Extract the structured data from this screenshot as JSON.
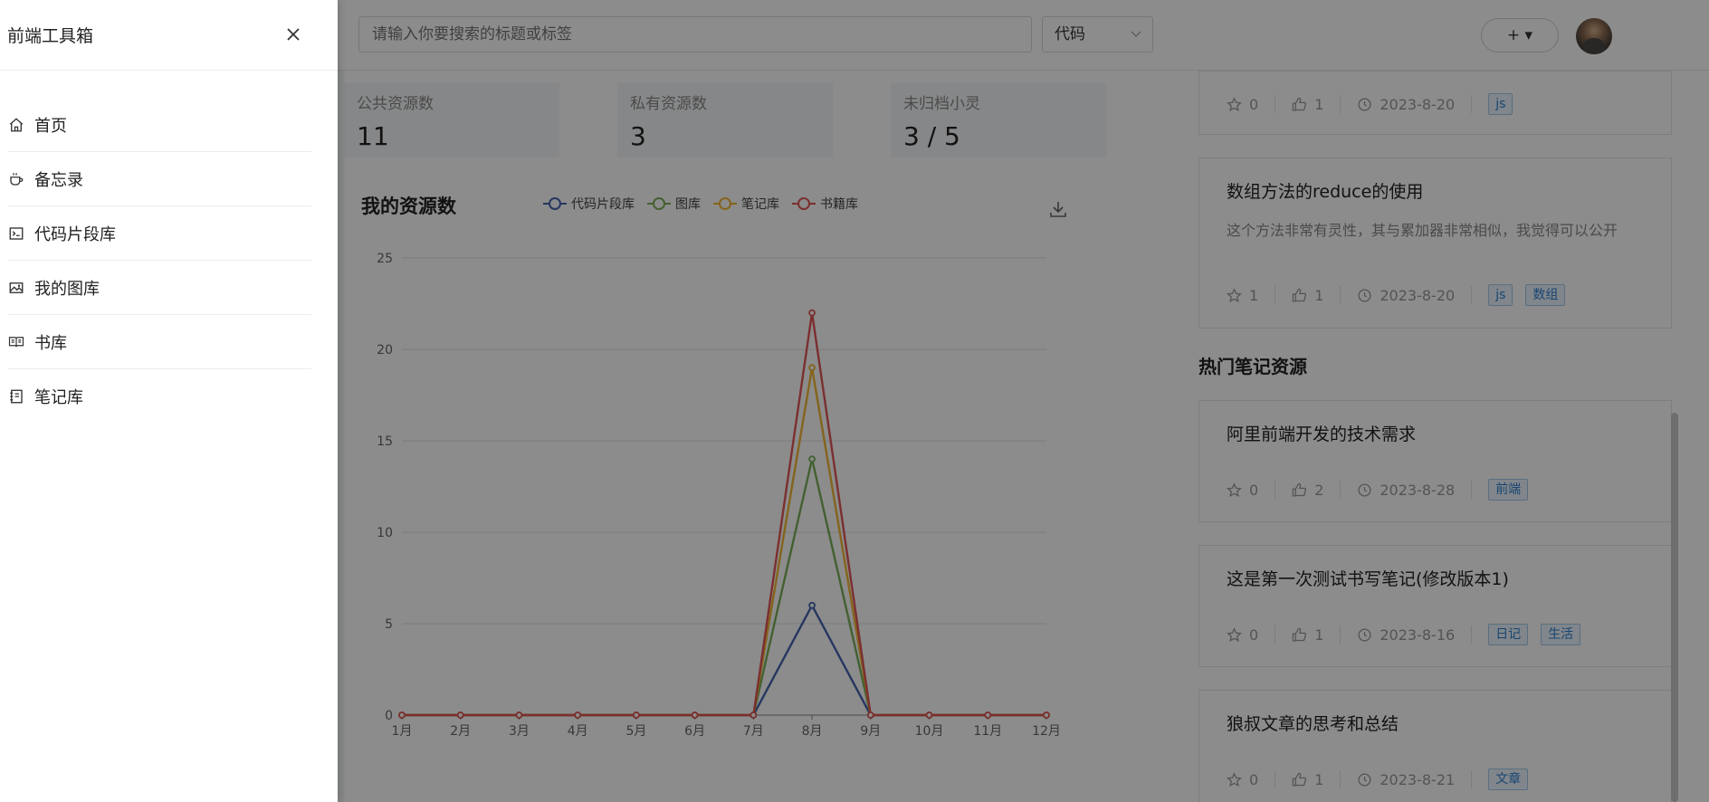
{
  "topbar": {
    "search_placeholder": "请输入你要搜索的标题或标签",
    "select_value": "代码",
    "add_label": "+ ▾"
  },
  "stats": [
    {
      "label": "公共资源数",
      "value": "11"
    },
    {
      "label": "私有资源数",
      "value": "3"
    },
    {
      "label": "未归档小灵",
      "value": "3 / 5"
    }
  ],
  "chart_section": {
    "title": "我的资源数",
    "download_icon": "download-icon"
  },
  "chart_data": {
    "type": "line",
    "title": "我的资源数",
    "categories": [
      "1月",
      "2月",
      "3月",
      "4月",
      "5月",
      "6月",
      "7月",
      "8月",
      "9月",
      "10月",
      "11月",
      "12月"
    ],
    "ylim": [
      0,
      25
    ],
    "yticks": [
      0,
      5,
      10,
      15,
      20,
      25
    ],
    "grid": true,
    "legend_position": "top",
    "series": [
      {
        "name": "代码片段库",
        "color": "#4564b0",
        "values": [
          0,
          0,
          0,
          0,
          0,
          0,
          0,
          6,
          0,
          0,
          0,
          0
        ]
      },
      {
        "name": "图库",
        "color": "#7ab05a",
        "values": [
          0,
          0,
          0,
          0,
          0,
          0,
          0,
          14,
          0,
          0,
          0,
          0
        ]
      },
      {
        "name": "笔记库",
        "color": "#f1b636",
        "values": [
          0,
          0,
          0,
          0,
          0,
          0,
          0,
          19,
          0,
          0,
          0,
          0
        ]
      },
      {
        "name": "书籍库",
        "color": "#e05657",
        "values": [
          0,
          0,
          0,
          0,
          0,
          0,
          0,
          22,
          0,
          0,
          0,
          0
        ]
      }
    ]
  },
  "code_cards": [
    {
      "title": "",
      "desc": "",
      "stars": "0",
      "likes": "1",
      "date": "2023-8-20",
      "tags": [
        "js"
      ]
    },
    {
      "title": "数组方法的reduce的使用",
      "desc": "这个方法非常有灵性，其与累加器非常相似，我觉得可以公开",
      "stars": "1",
      "likes": "1",
      "date": "2023-8-20",
      "tags": [
        "js",
        "数组"
      ]
    }
  ],
  "notes_section": {
    "title": "热门笔记资源"
  },
  "note_cards": [
    {
      "title": "阿里前端开发的技术需求",
      "stars": "0",
      "likes": "2",
      "date": "2023-8-28",
      "tags": [
        "前端"
      ]
    },
    {
      "title": "这是第一次测试书写笔记(修改版本1)",
      "stars": "0",
      "likes": "1",
      "date": "2023-8-16",
      "tags": [
        "日记",
        "生活"
      ]
    },
    {
      "title": "狼叔文章的思考和总结",
      "stars": "0",
      "likes": "1",
      "date": "2023-8-21",
      "tags": [
        "文章"
      ]
    }
  ],
  "drawer": {
    "title": "前端工具箱",
    "close_icon": "close-icon",
    "items": [
      {
        "label": "首页",
        "icon": "home-icon"
      },
      {
        "label": "备忘录",
        "icon": "coffee-cup-icon"
      },
      {
        "label": "代码片段库",
        "icon": "terminal-icon"
      },
      {
        "label": "我的图库",
        "icon": "picture-icon"
      },
      {
        "label": "书库",
        "icon": "book-icon"
      },
      {
        "label": "笔记库",
        "icon": "notebook-icon"
      }
    ]
  },
  "overlay_color": "#000000"
}
